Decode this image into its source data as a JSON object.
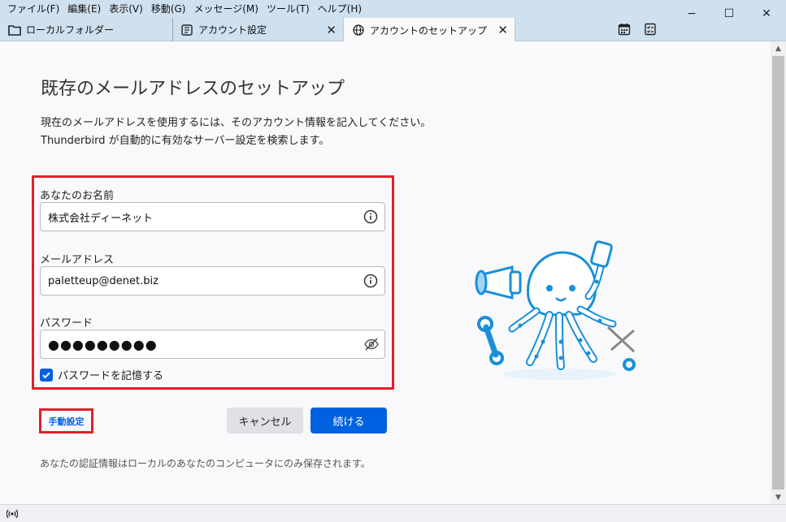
{
  "menu": [
    "ファイル(F)",
    "編集(E)",
    "表示(V)",
    "移動(G)",
    "メッセージ(M)",
    "ツール(T)",
    "ヘルプ(H)"
  ],
  "window_controls": {
    "minimize": "−",
    "maximize": "☐",
    "close": "✕"
  },
  "tabs": [
    {
      "label": "ローカルフォルダー",
      "icon": "folder-icon"
    },
    {
      "label": "アカウント設定",
      "icon": "settings-page-icon",
      "close": "✕"
    },
    {
      "label": "アカウントのセットアップ",
      "icon": "globe-icon",
      "close": "✕",
      "active": true
    }
  ],
  "toolbar_icons": [
    "calendar-icon",
    "tasks-icon"
  ],
  "page": {
    "title": "既存のメールアドレスのセットアップ",
    "desc_line1": "現在のメールアドレスを使用するには、そのアカウント情報を記入してください。",
    "desc_line2": "Thunderbird が自動的に有効なサーバー設定を検索します。"
  },
  "form": {
    "name_label": "あなたのお名前",
    "name_value": "株式会社ディーネット",
    "email_label": "メールアドレス",
    "email_value": "paletteup@denet.biz",
    "password_label": "パスワード",
    "password_mask": "●●●●●●●●●",
    "remember_label": "パスワードを記憶する",
    "remember_checked": true
  },
  "actions": {
    "manual": "手動設定",
    "cancel": "キャンセル",
    "continue": "続ける"
  },
  "footer_note": "あなたの認証情報はローカルのあなたのコンピュータにのみ保存されます。",
  "colors": {
    "accent": "#0061e0",
    "highlight": "#e0212b",
    "tabbar": "#cfe0ee"
  }
}
